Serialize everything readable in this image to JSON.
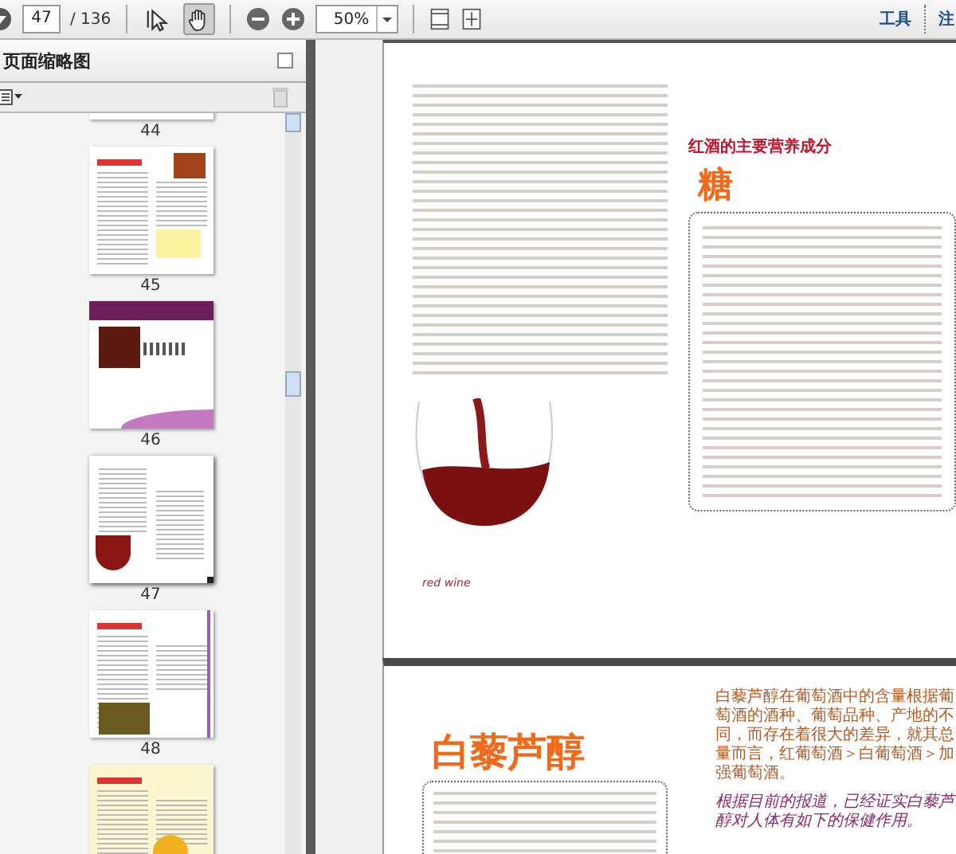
{
  "toolbar": {
    "page_number": "47",
    "page_total": "/ 136",
    "zoom": "50%",
    "tools": [
      {
        "kind": "select",
        "selected": false
      },
      {
        "kind": "hand",
        "selected": true
      }
    ],
    "menus": [
      "工具",
      "注"
    ]
  },
  "sidebar": {
    "title": "页面缩略图",
    "thumbnails": [
      {
        "label": "44",
        "kind": "cut",
        "selected": false
      },
      {
        "label": "45",
        "kind": "article",
        "selected": false
      },
      {
        "label": "46",
        "kind": "chapter",
        "selected": false
      },
      {
        "label": "47",
        "kind": "wine",
        "selected": true
      },
      {
        "label": "48",
        "kind": "photo",
        "selected": false
      },
      {
        "kind": "yellow",
        "selected": false
      }
    ]
  },
  "pages": [
    {
      "section_heading": "红酒的主要营养成分",
      "title": "糖",
      "caption": "red wine"
    },
    {
      "title": "白藜芦醇",
      "paragraphs": [
        "白藜芦醇在葡萄酒中的含量根据葡萄酒的酒种、葡萄品种、产地的不同，而存在着很大的差异，就其总量而言，红葡萄酒＞白葡萄酒＞加强葡萄酒。",
        "根据目前的报道，已经证实白藜芦醇对人体有如下的保健作用。"
      ]
    }
  ]
}
